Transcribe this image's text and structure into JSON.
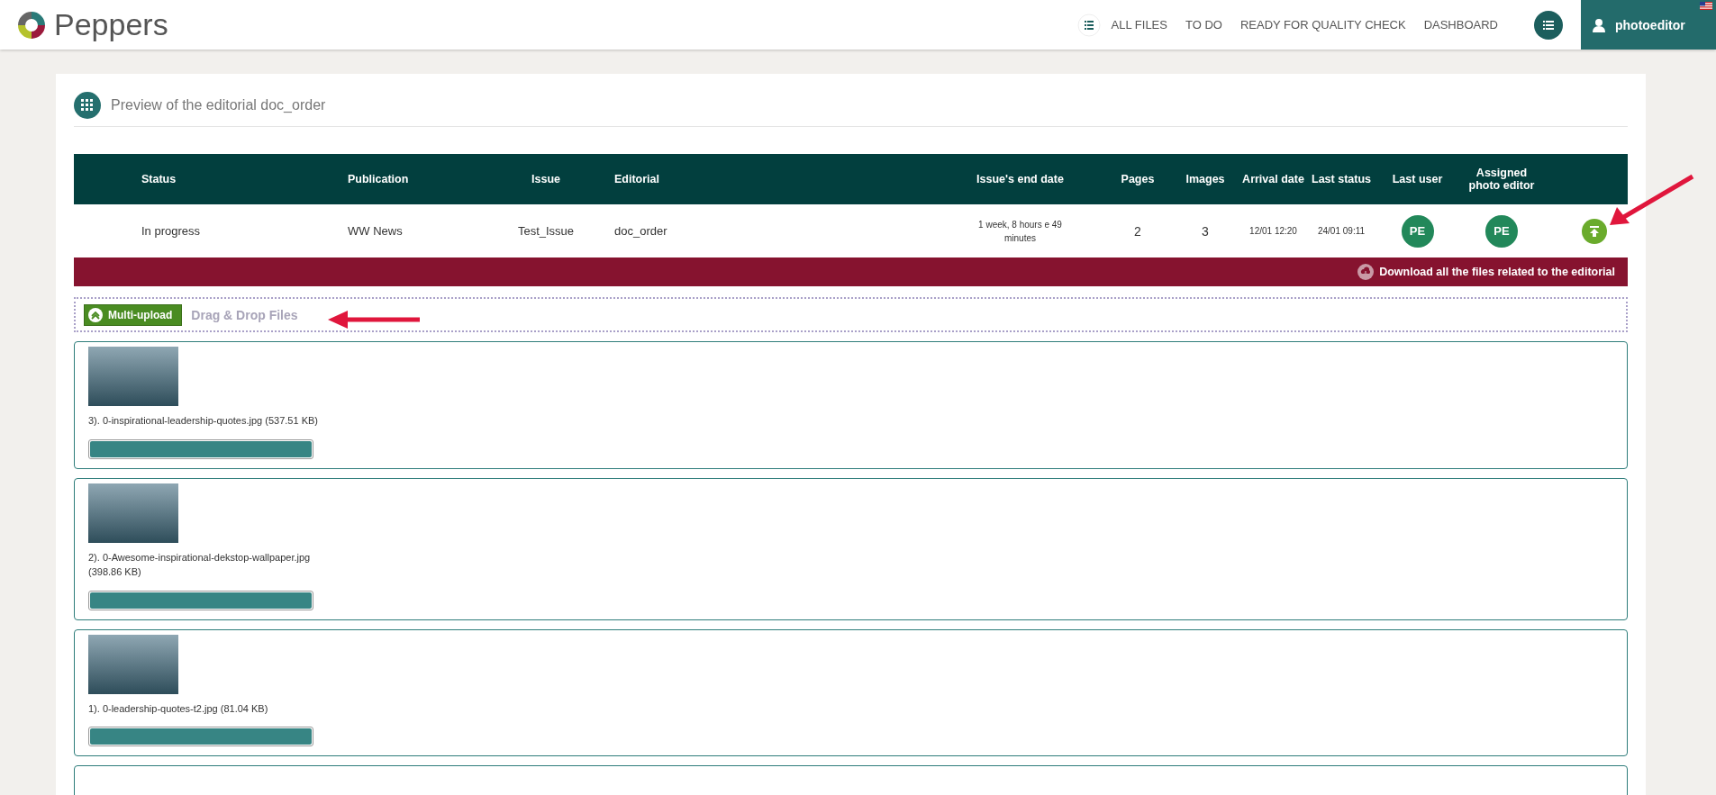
{
  "header": {
    "logo_text": "Peppers",
    "nav": [
      "ALL FILES",
      "TO DO",
      "READY FOR QUALITY CHECK",
      "DASHBOARD"
    ],
    "user": "photoeditor"
  },
  "page_title": "Preview of the editorial doc_order",
  "table": {
    "columns": [
      "Status",
      "Publication",
      "Issue",
      "Editorial",
      "Issue's end date",
      "Pages",
      "Images",
      "Arrival date",
      "Last status",
      "Last user",
      "Assigned photo editor"
    ],
    "rows": [
      {
        "cells": [
          {
            "kind": "text",
            "text": "In progress"
          },
          {
            "kind": "text",
            "text": "WW News"
          },
          {
            "kind": "text",
            "text": "Test_Issue"
          },
          {
            "kind": "text",
            "text": "doc_order"
          },
          {
            "kind": "small",
            "text": "1 week, 8 hours e 49 minutes"
          },
          {
            "kind": "number",
            "text": "2"
          },
          {
            "kind": "number",
            "text": "3"
          },
          {
            "kind": "small",
            "text": "12/01 12:20"
          },
          {
            "kind": "small",
            "text": "24/01 09:11"
          },
          {
            "kind": "avatar",
            "text": "PE"
          },
          {
            "kind": "avatar",
            "text": "PE"
          },
          {
            "kind": "upload"
          }
        ]
      }
    ]
  },
  "download_bar": "Download all the files related to the editorial",
  "upload": {
    "button": "Multi-upload",
    "drop_hint": "Drag & Drop Files"
  },
  "files": [
    {
      "label": "3). 0-inspirational-leadership-quotes.jpg (537.51 KB)",
      "level": 1
    },
    {
      "label": "2). 0-Awesome-inspirational-dekstop-wallpaper.jpg (398.86 KB)",
      "level": 1
    },
    {
      "label": "1). 0-leadership-quotes-t2.jpg (81.04 KB)",
      "level": 1
    }
  ]
}
